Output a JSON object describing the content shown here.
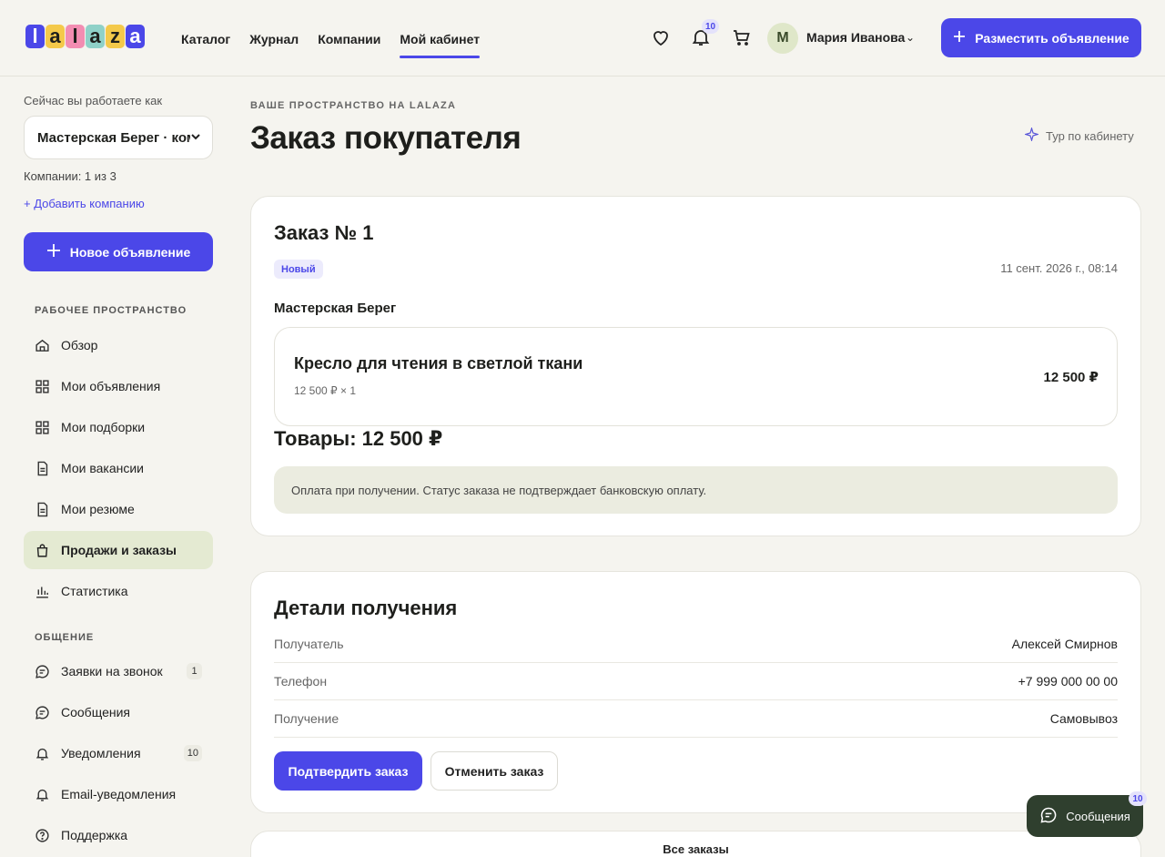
{
  "header": {
    "logo_letters": [
      "l",
      "a",
      "l",
      "a",
      "z",
      "a"
    ],
    "logo_colors": [
      "#4b47e8",
      "#f4c94a",
      "#f28db2",
      "#8fd1c8",
      "#f4c94a",
      "#4b47e8"
    ],
    "nav": [
      {
        "label": "Каталог",
        "active": false
      },
      {
        "label": "Журнал",
        "active": false
      },
      {
        "label": "Компании",
        "active": false
      },
      {
        "label": "Мой кабинет",
        "active": true
      }
    ],
    "notifications_count": "10",
    "avatar_letter": "М",
    "user_name": "Мария Иванова",
    "post_button": "Разместить объявление"
  },
  "sidebar": {
    "working_as_label": "Сейчас вы работаете как",
    "company_select_value": "Мастерская Берег · ком",
    "company_count": "Компании: 1 из 3",
    "add_company": "+ Добавить компанию",
    "new_ad_button": "Новое объявление",
    "workspace_title": "РАБОЧЕЕ ПРОСТРАНСТВО",
    "workspace_items": [
      {
        "label": "Обзор",
        "icon": "home-icon"
      },
      {
        "label": "Мои объявления",
        "icon": "grid-icon"
      },
      {
        "label": "Мои подборки",
        "icon": "grid-icon"
      },
      {
        "label": "Мои вакансии",
        "icon": "document-icon"
      },
      {
        "label": "Мои резюме",
        "icon": "document-icon"
      },
      {
        "label": "Продажи и заказы",
        "icon": "shopping-bag-icon",
        "active": true
      },
      {
        "label": "Статистика",
        "icon": "bar-chart-icon"
      }
    ],
    "communication_title": "ОБЩЕНИЕ",
    "communication_items": [
      {
        "label": "Заявки на звонок",
        "icon": "chat-icon",
        "badge": "1"
      },
      {
        "label": "Сообщения",
        "icon": "chat-icon"
      },
      {
        "label": "Уведомления",
        "icon": "bell-icon",
        "badge": "10"
      },
      {
        "label": "Email-уведомления",
        "icon": "bell-icon"
      },
      {
        "label": "Поддержка",
        "icon": "help-icon"
      }
    ]
  },
  "main": {
    "eyebrow": "ВАШЕ ПРОСТРАНСТВО НА LALAZA",
    "title": "Заказ покупателя",
    "tour_link": "Тур по кабинету",
    "order": {
      "title": "Заказ № 1",
      "status": "Новый",
      "date": "11 сент. 2026 г., 08:14",
      "shop": "Мастерская Берег",
      "item_title": "Кресло для чтения в светлой ткани",
      "item_sub": "12 500 ₽ × 1",
      "item_price": "12 500 ₽",
      "total": "Товары: 12 500 ₽",
      "notice": "Оплата при получении. Статус заказа не подтверждает банковскую оплату."
    },
    "details": {
      "title": "Детали получения",
      "rows": [
        {
          "key": "Получатель",
          "value": "Алексей Смирнов"
        },
        {
          "key": "Телефон",
          "value": "+7 999 000 00 00"
        },
        {
          "key": "Получение",
          "value": "Самовывоз"
        }
      ],
      "confirm_button": "Подтвердить заказ",
      "cancel_button": "Отменить заказ"
    },
    "all_orders": "Все заказы"
  },
  "messages_fab": {
    "label": "Сообщения",
    "badge": "10"
  },
  "colors": {
    "accent": "#4b47e8",
    "background": "#f5f4ef",
    "active_item_bg": "#e4ead2",
    "fab_bg": "#2f3f2e"
  }
}
